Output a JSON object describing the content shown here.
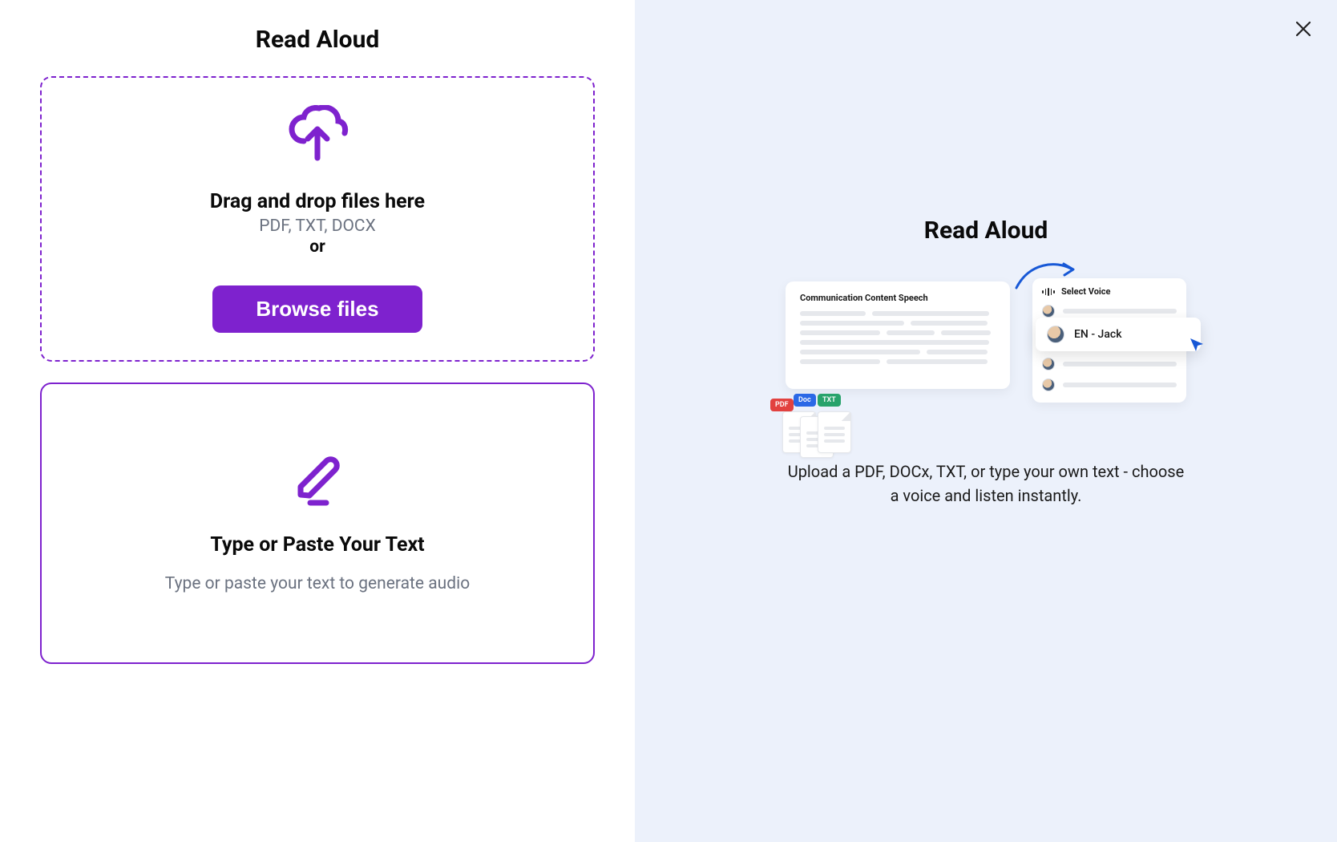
{
  "left": {
    "title": "Read Aloud",
    "dropzone": {
      "heading": "Drag and drop files here",
      "formats": "PDF, TXT, DOCX",
      "or_label": "or",
      "browse_label": "Browse files"
    },
    "text_card": {
      "heading": "Type or Paste Your Text",
      "subheading": "Type or paste your text to generate audio"
    }
  },
  "right": {
    "title": "Read Aloud",
    "description": "Upload a PDF, DOCx, TXT, or type your own text - choose a voice and listen instantly.",
    "illustration": {
      "doc_title": "Communication Content Speech",
      "chips": {
        "pdf": "PDF",
        "doc": "Doc",
        "txt": "TXT"
      },
      "voice_panel": {
        "header": "Select Voice",
        "selected": "EN - Jack"
      }
    }
  }
}
